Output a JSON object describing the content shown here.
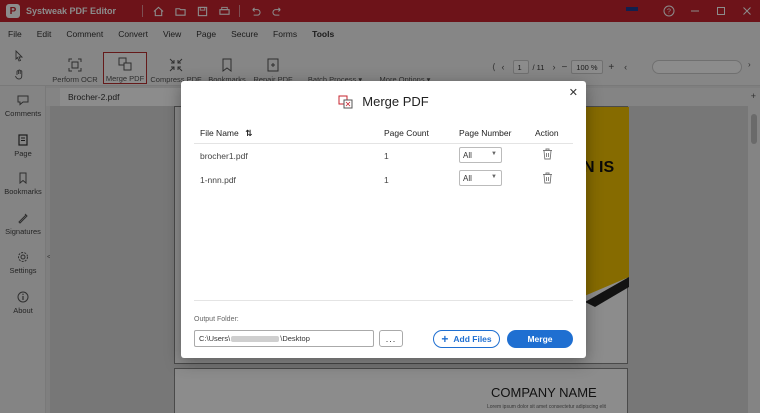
{
  "app": {
    "title": "Systweak PDF Editor",
    "logo_letter": "P"
  },
  "menu": [
    "File",
    "Edit",
    "Comment",
    "Convert",
    "View",
    "Page",
    "Secure",
    "Forms",
    "Tools"
  ],
  "toolbar": {
    "perform_ocr": "Perform OCR",
    "merge_pdf": "Merge PDF",
    "compress_pdf": "Compress PDF",
    "bookmarks": "Bookmarks",
    "repair_pdf": "Repair PDF",
    "batch_process": "Batch Process",
    "more_options": "More Options",
    "page_current": "1",
    "page_total": "/ 11",
    "zoom": "100 %",
    "zoom_out": "−",
    "zoom_in": "+"
  },
  "sidebar": {
    "comments": "Comments",
    "page": "Page",
    "bookmarks": "Bookmarks",
    "signatures": "Signatures",
    "settings": "Settings",
    "about": "About"
  },
  "document": {
    "tab_name": "Brocher-2.pdf",
    "page_heading_fragment": "N IS",
    "company_name": "COMPANY NAME",
    "company_sub": "Lorem ipsum dolor sit amet consectetur adipiscing elit"
  },
  "dialog": {
    "title": "Merge PDF",
    "headers": {
      "file_name": "File Name",
      "page_count": "Page Count",
      "page_number": "Page Number",
      "action": "Action"
    },
    "rows": [
      {
        "file": "brocher1.pdf",
        "count": "1",
        "page": "All"
      },
      {
        "file": "1-nnn.pdf",
        "count": "1",
        "page": "All"
      }
    ],
    "output_label": "Output Folder:",
    "output_path_prefix": "C:\\Users\\",
    "output_path_suffix": "\\Desktop",
    "browse": "...",
    "add_files": "Add Files",
    "merge": "Merge"
  },
  "colors": {
    "brand": "#c7232e",
    "accent": "#1f6fd1",
    "doc_yellow": "#f5c400"
  }
}
